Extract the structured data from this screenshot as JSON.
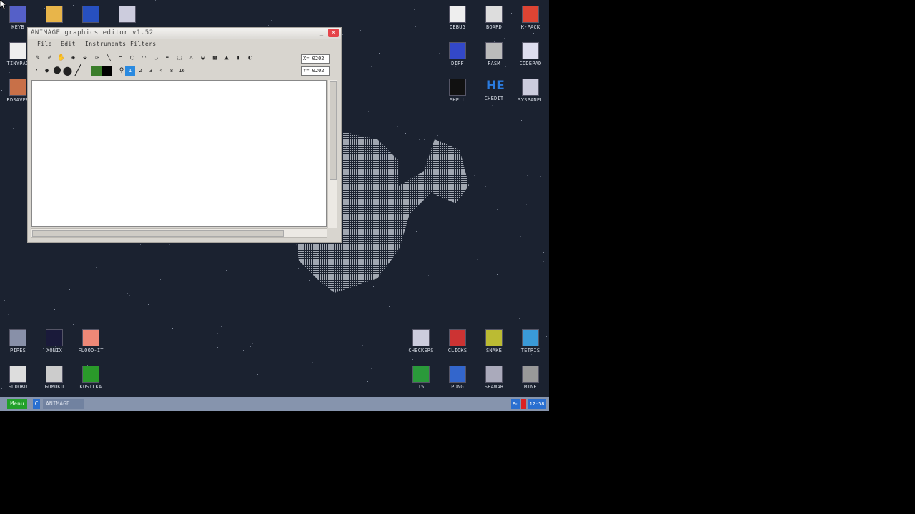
{
  "desktop": {
    "icons_top_left": [
      {
        "label": "KEYB",
        "icon": "floppy-icon"
      },
      {
        "label": "",
        "icon": "folder-icon"
      },
      {
        "label": "",
        "icon": "picture-icon"
      },
      {
        "label": "",
        "icon": "calculator-icon"
      },
      {
        "label": "TINYPAD",
        "icon": "notepad-icon"
      },
      {
        "label": "RDSAVER",
        "icon": "screensaver-icon"
      }
    ],
    "icons_top_right": [
      {
        "label": "DEBUG",
        "icon": "bug-icon"
      },
      {
        "label": "BOARD",
        "icon": "board-icon"
      },
      {
        "label": "K-PACK",
        "icon": "package-icon"
      },
      {
        "label": "DIFF",
        "icon": "calendar-grid-icon"
      },
      {
        "label": "FASM",
        "icon": "eagle-icon"
      },
      {
        "label": "CODEPAD",
        "icon": "cabinet-icon"
      },
      {
        "label": "SHELL",
        "icon": "terminal-icon"
      },
      {
        "label": "CHEDIT",
        "icon": "he-icon"
      },
      {
        "label": "SYSPANEL",
        "icon": "panel-icon"
      }
    ],
    "icons_bottom_left": [
      {
        "label": "PIPES",
        "icon": "pipes-icon"
      },
      {
        "label": "XONIX",
        "icon": "xonix-icon"
      },
      {
        "label": "FLOOD-IT",
        "icon": "flood-icon"
      },
      {
        "label": "SUDOKU",
        "icon": "sudoku-icon"
      },
      {
        "label": "GOMOKU",
        "icon": "gomoku-icon"
      },
      {
        "label": "KOSILKA",
        "icon": "lawnmower-icon"
      }
    ],
    "icons_bottom_right": [
      {
        "label": "CHECKERS",
        "icon": "checkers-icon"
      },
      {
        "label": "CLICKS",
        "icon": "clicks-icon"
      },
      {
        "label": "SNAKE",
        "icon": "snake-icon"
      },
      {
        "label": "TETRIS",
        "icon": "tetris-icon"
      },
      {
        "label": "15",
        "icon": "fifteen-icon"
      },
      {
        "label": "PONG",
        "icon": "pong-icon"
      },
      {
        "label": "SEAWAR",
        "icon": "seawar-icon"
      },
      {
        "label": "MINE",
        "icon": "mine-icon"
      }
    ]
  },
  "window": {
    "title": "ANIMAGE graphics editor v1.52",
    "min_label": "_",
    "close_label": "×",
    "menus": [
      "File",
      "Edit",
      "Instruments",
      "Filters"
    ],
    "tools_row1": [
      "✎",
      "✐",
      "✋",
      "◈",
      "⬙",
      "✑",
      "╲",
      "⌐",
      "◯",
      "◠",
      "◡",
      "⋯",
      "⬚",
      "♙",
      "◒",
      "▩",
      "▲",
      "▮",
      "◐"
    ],
    "tools_row2": [
      "•",
      "●",
      "⬤",
      "⬤",
      "╱"
    ],
    "line_widths": [
      "1",
      "2",
      "3",
      "4",
      "8",
      "16"
    ],
    "coord_x": "X= 0202",
    "coord_y": "Y= 0202"
  },
  "taskbar": {
    "menu_label": "Menu",
    "task_icon_label": "C",
    "task_item_label": "ANIMAGE",
    "lang_label": "En",
    "clock": "12:58"
  }
}
